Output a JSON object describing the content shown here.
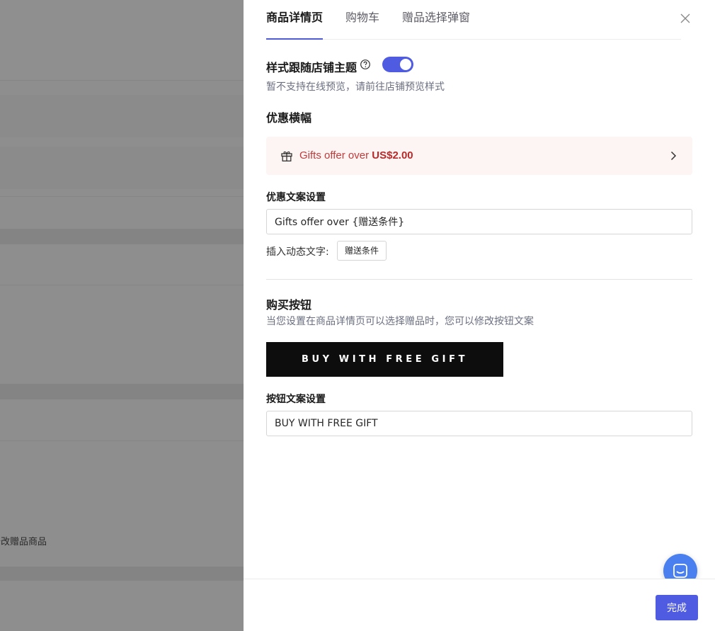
{
  "background": {
    "partial_text": "修改赠品商品"
  },
  "tabs": [
    {
      "label": "商品详情页",
      "active": true
    },
    {
      "label": "购物车",
      "active": false
    },
    {
      "label": "赠品选择弹窗",
      "active": false
    }
  ],
  "theme": {
    "title": "样式跟随店铺主题",
    "enabled": true,
    "hint": "暂不支持在线预览，请前往店铺预览样式"
  },
  "promo": {
    "title": "优惠横幅",
    "banner_prefix": "Gifts offer over ",
    "banner_amount": "US$2.00",
    "copy_label": "优惠文案设置",
    "copy_value": "Gifts offer over {赠送条件}",
    "insert_label": "插入动态文字:",
    "insert_chip": "赠送条件"
  },
  "buy_button": {
    "title": "购买按钮",
    "hint": "当您设置在商品详情页可以选择赠品时，您可以修改按钮文案",
    "preview_label": "BUY WITH FREE GIFT",
    "copy_label": "按钮文案设置",
    "copy_value": "BUY WITH FREE GIFT"
  },
  "footer": {
    "done_label": "完成"
  },
  "colors": {
    "accent": "#4f5be0",
    "banner_bg": "#fdf4f4",
    "banner_text": "#c13b3b",
    "chat": "#4a7ff0"
  }
}
